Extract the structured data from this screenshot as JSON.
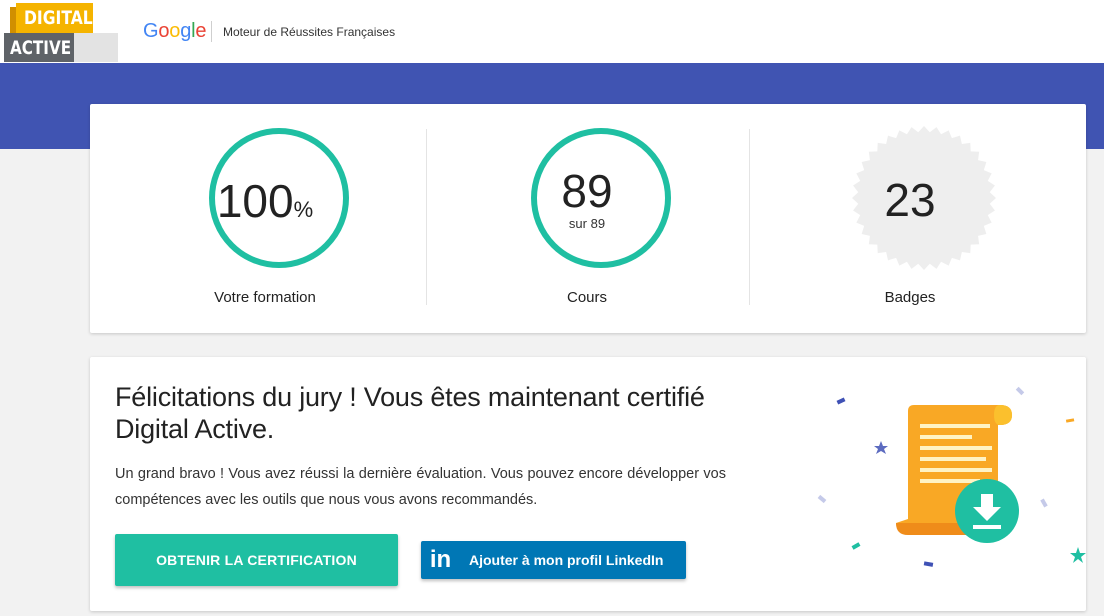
{
  "header": {
    "logo": {
      "line1": "DIGITAL",
      "line2": "ACTIVE"
    },
    "google": "Google",
    "tagline": "Moteur de Réussites Françaises"
  },
  "stats": {
    "formation": {
      "value": "100",
      "unit": "%",
      "label": "Votre formation",
      "progress_percent": 100
    },
    "cours": {
      "value": "89",
      "sub": "sur 89",
      "label": "Cours",
      "completed": 89,
      "total": 89
    },
    "badges": {
      "value": "23",
      "label": "Badges"
    }
  },
  "certification": {
    "title": "Félicitations du jury ! Vous êtes maintenant certifié Digital Active.",
    "text": "Un grand bravo ! Vous avez réussi la dernière évaluation. Vous pouvez encore développer vos compétences avec les outils que nous vous avons recommandés.",
    "cert_button": "OBTENIR LA CERTIFICATION",
    "linkedin_icon": "in",
    "linkedin_button": "Ajouter à mon profil LinkedIn",
    "illustration_icon": "certificate-scroll-download-icon"
  },
  "colors": {
    "accent": "#1fbfa2",
    "band": "#4054b2",
    "linkedin": "#0077b5",
    "logo_yellow": "#f5b400",
    "scroll_orange": "#f9a825"
  }
}
